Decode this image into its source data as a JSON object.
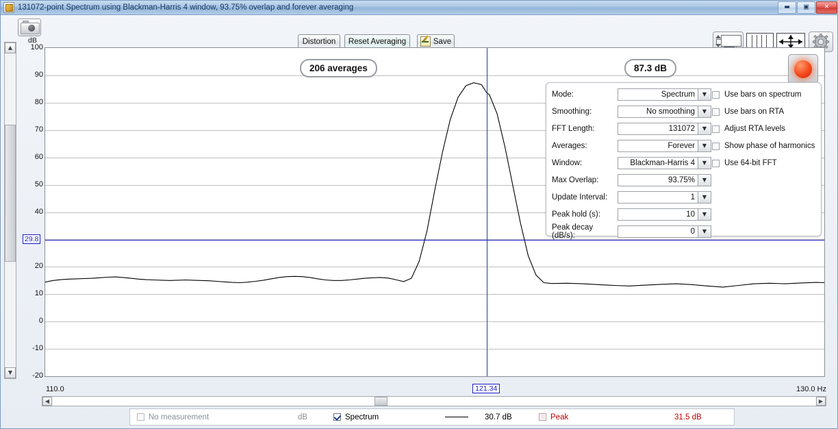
{
  "window": {
    "title": "131072-point Spectrum using Blackman-Harris 4 window, 93.75% overlap and forever averaging",
    "minimize_label": "—",
    "maximize_label": "□",
    "close_label": "✕"
  },
  "toolbar": {
    "snapshot_icon": "camera-icon",
    "distortion_label": "Distortion",
    "reset_averaging_label": "Reset Averaging",
    "save_label": "Save",
    "icons": [
      {
        "name": "scroll-pane-icon"
      },
      {
        "name": "columns-icon"
      },
      {
        "name": "move-arrows-icon"
      },
      {
        "name": "gear-icon"
      }
    ]
  },
  "plot": {
    "y_unit": "dB",
    "y_ticks": [
      "100",
      "90",
      "80",
      "70",
      "60",
      "50",
      "40",
      "20",
      "10",
      "0",
      "-10",
      "-20"
    ],
    "x_min_label": "110.0",
    "x_max_label": "130.0 Hz",
    "cursor_y_label": "29.8",
    "cursor_x_label": "121.34",
    "averages_badge": "206 averages",
    "level_badge": "87.3 dB",
    "record_button": "record-button",
    "cursor_color": "#2222cc"
  },
  "settings": {
    "rows": [
      {
        "label": "Mode:",
        "value": "Spectrum"
      },
      {
        "label": "Smoothing:",
        "value": "No  smoothing"
      },
      {
        "label": "FFT Length:",
        "value": "131072"
      },
      {
        "label": "Averages:",
        "value": "Forever"
      },
      {
        "label": "Window:",
        "value": "Blackman-Harris 4"
      },
      {
        "label": "Max Overlap:",
        "value": "93.75%"
      },
      {
        "label": "Update Interval:",
        "value": "1"
      },
      {
        "label": "Peak hold (s):",
        "value": "10"
      },
      {
        "label": "Peak decay (dB/s):",
        "value": "0"
      }
    ],
    "checkboxes": [
      {
        "label": "Use bars on spectrum",
        "checked": false
      },
      {
        "label": "Use bars on RTA",
        "checked": false
      },
      {
        "label": "Adjust RTA levels",
        "checked": false
      },
      {
        "label": "Show phase of harmonics",
        "checked": false
      },
      {
        "label": "Use 64-bit FFT",
        "checked": false
      }
    ]
  },
  "status": {
    "no_measurement_label": "No measurement",
    "db_unit": "dB",
    "spectrum_label": "Spectrum",
    "spectrum_value": "30.7 dB",
    "peak_label": "Peak",
    "peak_value": "31.5 dB",
    "peak_color": "#c00000"
  },
  "chart_data": {
    "type": "line",
    "title": "131072-point Spectrum using Blackman-Harris 4 window, 93.75% overlap and forever averaging",
    "xlabel": "Hz",
    "ylabel": "dB",
    "xlim": [
      110.0,
      130.0
    ],
    "ylim": [
      -20,
      100
    ],
    "ytick_step": 10,
    "grid": true,
    "legend": "none",
    "cursor": {
      "x": 121.34,
      "y": 29.8,
      "level_at_cursor": "87.3 dB"
    },
    "annotations": [
      "206 averages",
      "87.3 dB"
    ],
    "series": [
      {
        "name": "Spectrum",
        "color": "#000000",
        "x": [
          110.0,
          110.2,
          110.4,
          110.6,
          110.8,
          111.0,
          111.2,
          111.4,
          111.6,
          111.8,
          112.0,
          112.2,
          112.4,
          112.6,
          112.8,
          113.0,
          113.2,
          113.4,
          113.6,
          113.8,
          114.0,
          114.2,
          114.4,
          114.6,
          114.8,
          115.0,
          115.2,
          115.4,
          115.6,
          115.8,
          116.0,
          116.2,
          116.4,
          116.6,
          116.8,
          117.0,
          117.2,
          117.4,
          117.6,
          117.8,
          118.0,
          118.2,
          118.4,
          118.6,
          118.8,
          119.0,
          119.2,
          119.4,
          119.6,
          119.8,
          120.0,
          120.2,
          120.4,
          120.6,
          120.8,
          121.0,
          121.2,
          121.34,
          121.4,
          121.6,
          121.8,
          122.0,
          122.2,
          122.4,
          122.6,
          122.8,
          123.0,
          123.4,
          123.8,
          124.2,
          124.6,
          125.0,
          125.4,
          125.8,
          126.2,
          126.6,
          127.0,
          127.4,
          127.8,
          128.2,
          128.6,
          129.0,
          129.4,
          129.8,
          130.0
        ],
        "y": [
          14.4,
          15.0,
          15.3,
          15.5,
          15.6,
          15.7,
          15.8,
          16.0,
          16.2,
          16.3,
          16.1,
          15.8,
          15.5,
          15.3,
          15.2,
          15.1,
          15.0,
          15.1,
          15.2,
          15.1,
          15.0,
          14.9,
          14.7,
          14.5,
          14.3,
          14.2,
          14.4,
          14.7,
          15.1,
          15.6,
          16.1,
          16.4,
          16.5,
          16.4,
          16.1,
          15.6,
          15.2,
          15.0,
          15.0,
          15.2,
          15.5,
          15.8,
          16.0,
          16.1,
          15.9,
          15.3,
          14.6,
          15.8,
          22.0,
          33.0,
          48.0,
          62.0,
          74.0,
          82.0,
          86.2,
          87.3,
          86.6,
          83.5,
          83.0,
          76.0,
          64.0,
          50.0,
          36.0,
          24.0,
          17.0,
          14.2,
          13.9,
          14.0,
          13.8,
          13.5,
          13.2,
          13.0,
          13.3,
          13.6,
          13.8,
          13.5,
          13.0,
          12.6,
          13.2,
          13.8,
          14.0,
          13.8,
          14.1,
          14.3,
          14.2
        ]
      }
    ]
  }
}
